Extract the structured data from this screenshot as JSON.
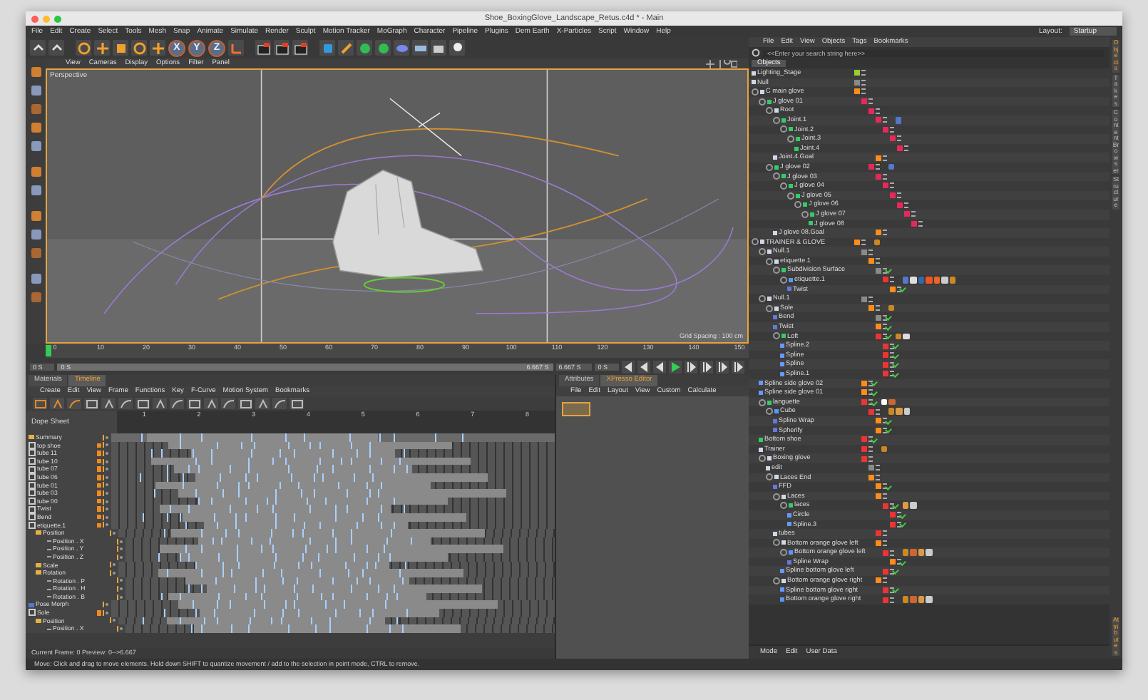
{
  "window": {
    "title": "Shoe_BoxingGlove_Landscape_Retus.c4d * - Main"
  },
  "menu": [
    "File",
    "Edit",
    "Create",
    "Select",
    "Tools",
    "Mesh",
    "Snap",
    "Animate",
    "Simulate",
    "Render",
    "Sculpt",
    "Motion Tracker",
    "MoGraph",
    "Character",
    "Pipeline",
    "Plugins",
    "Dem Earth",
    "X-Particles",
    "Script",
    "Window",
    "Help"
  ],
  "layout": {
    "label": "Layout:",
    "value": "Startup"
  },
  "axis_buttons": [
    "X",
    "Y",
    "Z"
  ],
  "viewport": {
    "menu": [
      "View",
      "Cameras",
      "Display",
      "Options",
      "Filter",
      "Panel"
    ],
    "camera": "Perspective",
    "grid_spacing": "Grid Spacing : 100 cm"
  },
  "ruler": {
    "ticks": [
      "0",
      "10",
      "20",
      "30",
      "40",
      "50",
      "60",
      "70",
      "80",
      "90",
      "100",
      "110",
      "120",
      "130",
      "140",
      "150"
    ],
    "level": 0
  },
  "transport": {
    "start": "0 S",
    "current": "0 S",
    "range_start": "0 S",
    "range_end": "6.667 S",
    "end": "6.667 S",
    "level": 1
  },
  "timeline": {
    "tabs": [
      {
        "label": "Materials",
        "selected": false
      },
      {
        "label": "Timeline",
        "selected": true
      }
    ],
    "menu": [
      "Create",
      "Edit",
      "View",
      "Frame",
      "Functions",
      "Key",
      "F-Curve",
      "Motion System",
      "Bookmarks"
    ],
    "title": "Dope Sheet",
    "ruler": [
      "1",
      "2",
      "3",
      "4",
      "5",
      "6",
      "7",
      "8"
    ],
    "rows": [
      {
        "name": "Summary",
        "kind": "summary"
      },
      {
        "name": "top shoe",
        "kind": "object"
      },
      {
        "name": "tube 11",
        "kind": "object"
      },
      {
        "name": "tube 10",
        "kind": "object"
      },
      {
        "name": "tube 07",
        "kind": "object"
      },
      {
        "name": "tube 06",
        "kind": "object"
      },
      {
        "name": "tube 01",
        "kind": "object"
      },
      {
        "name": "tube 03",
        "kind": "object"
      },
      {
        "name": "tube 00",
        "kind": "object"
      },
      {
        "name": "Twist",
        "kind": "object"
      },
      {
        "name": "Bend",
        "kind": "object"
      },
      {
        "name": "etiquette.1",
        "kind": "object",
        "children": [
          {
            "name": "Position",
            "kind": "folder",
            "children": [
              {
                "name": "Position . X",
                "kind": "track"
              },
              {
                "name": "Position . Y",
                "kind": "track"
              },
              {
                "name": "Position . Z",
                "kind": "track"
              }
            ]
          },
          {
            "name": "Scale",
            "kind": "folder"
          },
          {
            "name": "Rotation",
            "kind": "folder",
            "children": [
              {
                "name": "Rotation . P",
                "kind": "track"
              },
              {
                "name": "Rotation . H",
                "kind": "track"
              },
              {
                "name": "Rotation . B",
                "kind": "track"
              }
            ]
          }
        ]
      },
      {
        "name": "Pose Morph",
        "kind": "tag"
      },
      {
        "name": "Sole",
        "kind": "object",
        "children": [
          {
            "name": "Position",
            "kind": "folder",
            "children": [
              {
                "name": "Position . X",
                "kind": "track"
              }
            ]
          }
        ]
      }
    ],
    "footer": "Current Frame: 0  Preview: 0-->6.667"
  },
  "xpresso": {
    "tabs": [
      {
        "label": "Attributes",
        "selected": false
      },
      {
        "label": "XPresso Editor",
        "selected": true
      }
    ],
    "menu": [
      "File",
      "Edit",
      "Layout",
      "View",
      "Custom",
      "Calculate"
    ]
  },
  "objects_panel": {
    "menu": [
      "File",
      "Edit",
      "View",
      "Objects",
      "Tags",
      "Bookmarks"
    ],
    "search": {
      "placeholder": "<<Enter your search string here>>"
    },
    "tab": "Objects",
    "side_tabs": [
      {
        "label": "Objects",
        "selected": true
      },
      {
        "label": "Takes",
        "selected": false
      },
      {
        "label": "Content Browser",
        "selected": false
      },
      {
        "label": "Structure",
        "selected": false
      }
    ],
    "objects": [
      {
        "name": "Lighting_Stage",
        "kind": "null",
        "color": "#99cc33",
        "enabled": false
      },
      {
        "name": "Null",
        "kind": "null",
        "color": "#8a8a8a",
        "enabled": false
      },
      {
        "name": "C main glove",
        "kind": "null",
        "color": "#ff8c1a",
        "enabled": false,
        "children": [
          {
            "name": "J glove 01",
            "kind": "joint",
            "color": "#e8285a",
            "enabled": false,
            "children": [
              {
                "name": "Root",
                "kind": "null",
                "color": "#e8285a",
                "enabled": false,
                "children": [
                  {
                    "name": "Joint.1",
                    "kind": "joint",
                    "color": "#e8285a",
                    "enabled": false,
                    "tags": [
                      {
                        "color": "#5577cc"
                      }
                    ],
                    "children": [
                      {
                        "name": "Joint.2",
                        "kind": "joint",
                        "color": "#e8285a",
                        "enabled": false,
                        "children": [
                          {
                            "name": "Joint.3",
                            "kind": "joint",
                            "color": "#e8285a",
                            "enabled": false,
                            "children": [
                              {
                                "name": "Joint.4",
                                "kind": "joint",
                                "color": "#e8285a",
                                "enabled": false
                              }
                            ]
                          }
                        ]
                      }
                    ]
                  },
                  {
                    "name": "Joint.4.Goal",
                    "kind": "null",
                    "color": "#ff8c1a",
                    "enabled": false
                  }
                ]
              },
              {
                "name": "J glove 02",
                "kind": "joint",
                "color": "#e8285a",
                "enabled": false,
                "tags": [
                  {
                    "color": "#5577cc"
                  }
                ],
                "children": [
                  {
                    "name": "J glove 03",
                    "kind": "joint",
                    "color": "#e8285a",
                    "enabled": false,
                    "children": [
                      {
                        "name": "J glove 04",
                        "kind": "joint",
                        "color": "#e8285a",
                        "enabled": false,
                        "children": [
                          {
                            "name": "J glove 05",
                            "kind": "joint",
                            "color": "#e8285a",
                            "enabled": false,
                            "children": [
                              {
                                "name": "J glove 06",
                                "kind": "joint",
                                "color": "#e8285a",
                                "enabled": false,
                                "children": [
                                  {
                                    "name": "J glove 07",
                                    "kind": "joint",
                                    "color": "#e8285a",
                                    "enabled": false,
                                    "children": [
                                      {
                                        "name": "J glove 08",
                                        "kind": "joint",
                                        "color": "#e8285a",
                                        "enabled": false
                                      }
                                    ]
                                  }
                                ]
                              }
                            ]
                          }
                        ]
                      }
                    ]
                  },
                  {
                    "name": "J glove 08.Goal",
                    "kind": "null",
                    "color": "#ff8c1a",
                    "enabled": false
                  }
                ]
              }
            ]
          }
        ]
      },
      {
        "name": "TRAINER & GLOVE",
        "kind": "null",
        "color": "#ff8c1a",
        "enabled": false,
        "tags": [
          {
            "color": "#cc8822"
          }
        ],
        "children": [
          {
            "name": "Null.1",
            "kind": "null",
            "color": "#8a8a8a",
            "enabled": false,
            "children": [
              {
                "name": "etiquette.1",
                "kind": "null",
                "color": "#ff8c1a",
                "enabled": false,
                "children": [
                  {
                    "name": "Subdivision Surface",
                    "kind": "generator",
                    "color": "#8a8a8a",
                    "enabled": true,
                    "children": [
                      {
                        "name": "etiquette.1",
                        "kind": "mesh",
                        "color": "#ee3333",
                        "enabled": false,
                        "tags": [
                          {
                            "color": "#5577cc"
                          },
                          {
                            "color": "#dddddd"
                          },
                          {
                            "color": "#3366aa"
                          },
                          {
                            "color": "#ee5522"
                          },
                          {
                            "color": "#ee6622"
                          },
                          {
                            "color": "#cccccc"
                          },
                          {
                            "color": "#cc8822"
                          }
                        ],
                        "children": [
                          {
                            "name": "Twist",
                            "kind": "deformer",
                            "color": "#ff8c1a",
                            "enabled": true
                          }
                        ]
                      }
                    ]
                  }
                ]
              }
            ]
          },
          {
            "name": "Null.1",
            "kind": "null",
            "color": "#8a8a8a",
            "enabled": false,
            "children": [
              {
                "name": "Sole",
                "kind": "null",
                "color": "#ff8c1a",
                "enabled": false,
                "tags": [
                  {
                    "color": "#cc8822"
                  }
                ],
                "children": [
                  {
                    "name": "Bend",
                    "kind": "deformer",
                    "color": "#8a8a8a",
                    "enabled": true
                  },
                  {
                    "name": "Twist",
                    "kind": "deformer",
                    "color": "#ff8c1a",
                    "enabled": true
                  },
                  {
                    "name": "Loft",
                    "kind": "generator",
                    "color": "#ee3333",
                    "enabled": true,
                    "tags": [
                      {
                        "color": "#cc8822"
                      },
                      {
                        "color": "#dddddd"
                      }
                    ],
                    "children": [
                      {
                        "name": "Spline.2",
                        "kind": "spline",
                        "color": "#ee3333",
                        "enabled": true
                      },
                      {
                        "name": "Spline",
                        "kind": "spline",
                        "color": "#ee3333",
                        "enabled": true
                      },
                      {
                        "name": "Spline",
                        "kind": "spline",
                        "color": "#ee3333",
                        "enabled": true
                      },
                      {
                        "name": "Spline.1",
                        "kind": "spline",
                        "color": "#ee3333",
                        "enabled": true
                      }
                    ]
                  }
                ]
              }
            ]
          },
          {
            "name": "Spline side glove 02",
            "kind": "spline",
            "color": "#ff8c1a",
            "enabled": true
          },
          {
            "name": "Spline side glove 01",
            "kind": "spline",
            "color": "#ff8c1a",
            "enabled": true
          },
          {
            "name": "languette",
            "kind": "generator",
            "color": "#ee3333",
            "enabled": true,
            "tags": [
              {
                "color": "#ffffff"
              },
              {
                "color": "#cc6633"
              }
            ],
            "children": [
              {
                "name": "Cube",
                "kind": "mesh",
                "color": "#ee3333",
                "enabled": false,
                "tags": [
                  {
                    "color": "#cc8822"
                  },
                  {
                    "color": "#dd9944"
                  },
                  {
                    "color": "#cccccc"
                  }
                ],
                "children": [
                  {
                    "name": "Spline Wrap",
                    "kind": "deformer",
                    "color": "#ff8c1a",
                    "enabled": true
                  },
                  {
                    "name": "Spherify",
                    "kind": "deformer",
                    "color": "#ff8c1a",
                    "enabled": true
                  }
                ]
              }
            ]
          },
          {
            "name": "Bottom shoe",
            "kind": "generator",
            "color": "#ee3333",
            "enabled": true
          },
          {
            "name": "Trainer",
            "kind": "null",
            "color": "#ee3333",
            "enabled": false,
            "tags": [
              {
                "color": "#cc8822"
              }
            ]
          },
          {
            "name": "Boxing glove",
            "kind": "null",
            "color": "#ee3333",
            "enabled": false,
            "children": [
              {
                "name": "edit",
                "kind": "null",
                "color": "#8a8a8a",
                "enabled": false
              },
              {
                "name": "Laces End",
                "kind": "null",
                "color": "#ff8c1a",
                "enabled": false,
                "children": [
                  {
                    "name": "FFD",
                    "kind": "deformer",
                    "color": "#ff8c1a",
                    "enabled": true
                  },
                  {
                    "name": "Laces",
                    "kind": "null",
                    "color": "#ff8c1a",
                    "enabled": false,
                    "children": [
                      {
                        "name": "laces",
                        "kind": "generator",
                        "color": "#ee3333",
                        "enabled": true,
                        "tags": [
                          {
                            "color": "#dd9944"
                          },
                          {
                            "color": "#cccccc"
                          }
                        ],
                        "children": [
                          {
                            "name": "Circle",
                            "kind": "spline",
                            "color": "#ee3333",
                            "enabled": true
                          },
                          {
                            "name": "Spline.3",
                            "kind": "spline",
                            "color": "#ee3333",
                            "enabled": true
                          }
                        ]
                      }
                    ]
                  },
                  {
                    "name": "tubes",
                    "kind": "null",
                    "color": "#ee3333",
                    "enabled": false
                  },
                  {
                    "name": "Bottom orange glove left",
                    "kind": "null",
                    "color": "#ff8c1a",
                    "enabled": false,
                    "children": [
                      {
                        "name": "Bottom orange glove left",
                        "kind": "mesh",
                        "color": "#ee3333",
                        "enabled": false,
                        "tags": [
                          {
                            "color": "#cc8822"
                          },
                          {
                            "color": "#cc6633"
                          },
                          {
                            "color": "#dd9944"
                          },
                          {
                            "color": "#cccccc"
                          }
                        ],
                        "children": [
                          {
                            "name": "Spline Wrap",
                            "kind": "deformer",
                            "color": "#ff8c1a",
                            "enabled": true
                          }
                        ]
                      },
                      {
                        "name": "Spline bottom glove left",
                        "kind": "spline",
                        "color": "#ee3333",
                        "enabled": true
                      }
                    ]
                  },
                  {
                    "name": "Bottom orange glove right",
                    "kind": "null",
                    "color": "#ff8c1a",
                    "enabled": false,
                    "children": [
                      {
                        "name": "Spline bottom glove right",
                        "kind": "spline",
                        "color": "#ee3333",
                        "enabled": true
                      },
                      {
                        "name": "Bottom orange glove right",
                        "kind": "mesh",
                        "color": "#ee3333",
                        "enabled": false,
                        "tags": [
                          {
                            "color": "#cc8822"
                          },
                          {
                            "color": "#cc6633"
                          },
                          {
                            "color": "#dd9944"
                          },
                          {
                            "color": "#cccccc"
                          }
                        ]
                      }
                    ]
                  }
                ]
              }
            ]
          }
        ]
      }
    ]
  },
  "attributes_bar": {
    "menu": [
      "Mode",
      "Edit",
      "User Data"
    ],
    "side_tab": "Attributes"
  },
  "status_bar": "Move: Click and drag to move elements. Hold down SHIFT to quantize movement / add to the selection in point mode, CTRL to remove."
}
